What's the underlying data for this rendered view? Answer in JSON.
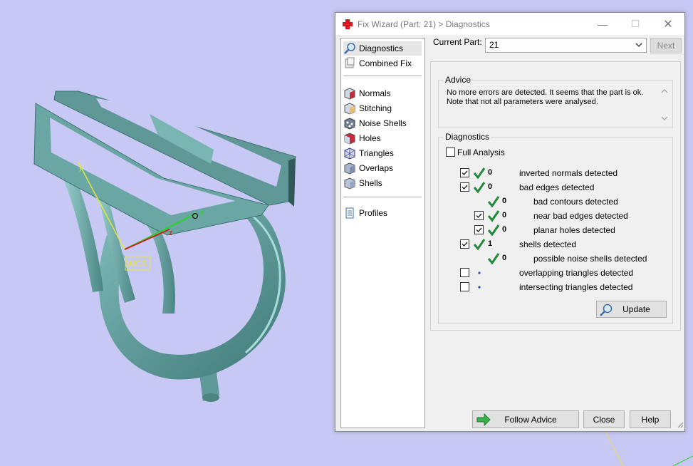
{
  "window": {
    "title": "Fix Wizard (Part: 21) > Diagnostics",
    "minimize": "—",
    "maximize": "☐",
    "close": "✕"
  },
  "viewport": {
    "wcs_label": "WCS",
    "axis_x": "x",
    "axis_y": "y",
    "axis_z": "z"
  },
  "nav": {
    "items": [
      {
        "label": "Diagnostics",
        "icon": "magnifier-icon"
      },
      {
        "label": "Combined Fix",
        "icon": "combined-fix-icon"
      },
      {
        "label": "Normals",
        "icon": "normals-cube-icon"
      },
      {
        "label": "Stitching",
        "icon": "stitching-cube-icon"
      },
      {
        "label": "Noise Shells",
        "icon": "noise-shells-icon"
      },
      {
        "label": "Holes",
        "icon": "holes-cube-icon"
      },
      {
        "label": "Triangles",
        "icon": "triangles-cube-icon"
      },
      {
        "label": "Overlaps",
        "icon": "overlaps-cube-icon"
      },
      {
        "label": "Shells",
        "icon": "shells-cube-icon"
      },
      {
        "label": "Profiles",
        "icon": "profiles-document-icon"
      }
    ],
    "selected": "Diagnostics"
  },
  "header": {
    "current_part_label": "Current Part:",
    "current_part_value": "21",
    "next_label": "Next"
  },
  "advice": {
    "title": "Advice",
    "text_line1": "No more errors are detected. It seems that the part is ok.",
    "text_line2": "Note that not all parameters were analysed."
  },
  "diagnostics": {
    "title": "Diagnostics",
    "full_analysis_label": "Full Analysis",
    "full_analysis_checked": false,
    "rows": [
      {
        "checked": true,
        "status": "ok",
        "count": "0",
        "label": "inverted normals detected"
      },
      {
        "checked": true,
        "status": "ok",
        "count": "0",
        "label": "bad edges detected"
      },
      {
        "checked": null,
        "status": "ok",
        "count": "0",
        "label": "bad contours detected"
      },
      {
        "checked": true,
        "status": "ok",
        "count": "0",
        "label": "near bad edges detected"
      },
      {
        "checked": true,
        "status": "ok",
        "count": "0",
        "label": "planar holes detected"
      },
      {
        "checked": true,
        "status": "ok",
        "count": "1",
        "label": "shells detected"
      },
      {
        "checked": null,
        "status": "ok",
        "count": "0",
        "label": "possible noise shells detected"
      },
      {
        "checked": false,
        "status": "none",
        "count": "",
        "label": "overlapping triangles detected"
      },
      {
        "checked": false,
        "status": "none",
        "count": "",
        "label": "intersecting triangles detected"
      }
    ],
    "update_label": "Update"
  },
  "footer": {
    "follow_advice_label": "Follow Advice",
    "close_label": "Close",
    "help_label": "Help"
  },
  "colors": {
    "viewport_bg": "#c8c8f5",
    "model": "#5e9c9a",
    "check_green": "#1f8a3a",
    "dialog_bg": "#f0f0f0"
  }
}
